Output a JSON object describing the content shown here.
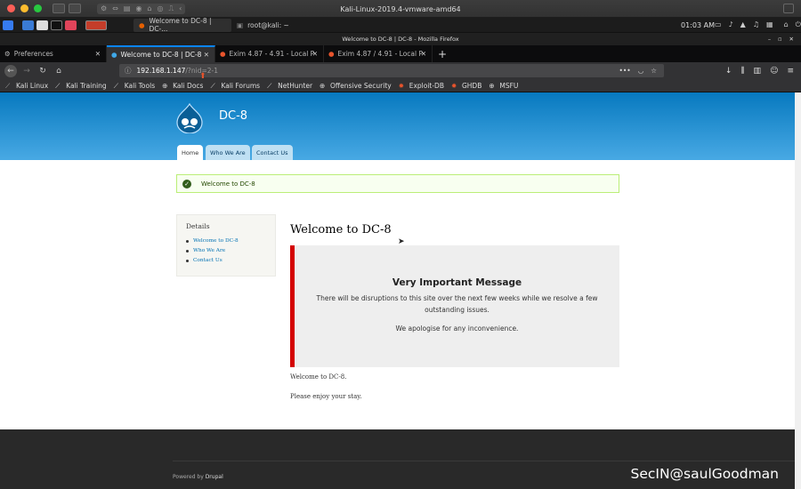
{
  "vm_title": "Kali-Linux-2019.4-vmware-amd64",
  "panel": {
    "task1": "Welcome to DC-8 | DC-...",
    "task2": "root@kali: ~",
    "time": "01:03 AM"
  },
  "firefox_title": "Welcome to DC-8 | DC-8 - Mozilla Firefox",
  "tabs": [
    {
      "label": "Preferences"
    },
    {
      "label": "Welcome to DC-8 | DC-8"
    },
    {
      "label": "Exim 4.87 - 4.91 - Local P"
    },
    {
      "label": "Exim 4.87 / 4.91 - Local P"
    }
  ],
  "url": {
    "host": "192.168.1.147",
    "path": "/?nid=2-1"
  },
  "bookmarks": [
    "Kali Linux",
    "Kali Training",
    "Kali Tools",
    "Kali Docs",
    "Kali Forums",
    "NetHunter",
    "Offensive Security",
    "Exploit-DB",
    "GHDB",
    "MSFU"
  ],
  "site": {
    "name": "DC-8",
    "tabs": [
      "Home",
      "Who We Are",
      "Contact Us"
    ],
    "status": "Welcome to DC-8",
    "sidebar_title": "Details",
    "sidebar_links": [
      "Welcome to DC-8",
      "Who We Are",
      "Contact Us"
    ],
    "heading": "Welcome to DC-8",
    "notice_title": "Very Important Message",
    "notice_p1": "There will be disruptions to this site over the next few weeks while we resolve a few outstanding issues.",
    "notice_p2": "We apologise for any inconvenience.",
    "body1": "Welcome to DC-8.",
    "body2": "Please enjoy your stay.",
    "footer_prefix": "Powered by ",
    "footer_link": "Drupal"
  },
  "watermark": "SecIN@saulGoodman",
  "colors": {
    "accent": "#0a84ff",
    "drupal_blue": "#0779bf",
    "alert_red": "#d40000"
  }
}
